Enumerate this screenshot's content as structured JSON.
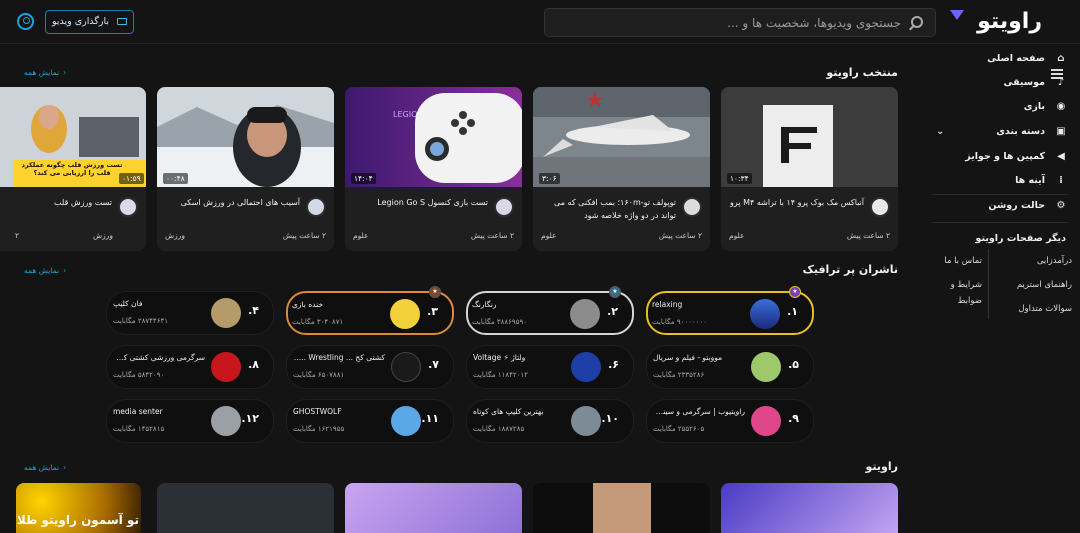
{
  "header": {
    "logo_text": "راویتو",
    "search_placeholder": "جستجوی ویدیوها، شخصیت ها و ...",
    "upload_label": "بارگذاری ویدیو"
  },
  "sidebar": {
    "items": [
      {
        "label": "صفحه اصلی",
        "icon": "home-icon"
      },
      {
        "label": "موسیقی",
        "icon": "music-icon"
      },
      {
        "label": "بازی",
        "icon": "gamepad-icon"
      },
      {
        "label": "دسته بندی",
        "icon": "category-icon"
      },
      {
        "label": "کمپین ها و جوایز",
        "icon": "megaphone-icon"
      },
      {
        "label": "آینه ها",
        "icon": "grid-icon"
      },
      {
        "label": "حالت روشن",
        "icon": "gear-icon"
      }
    ],
    "other_pages_title": "دیگر صفحات راویتو",
    "links_right": [
      "درآمدزایی",
      "راهنمای استریم",
      "سوالات متداول"
    ],
    "links_left": [
      "تماس با ما",
      "شرایط و ضوابط"
    ]
  },
  "sections": {
    "featured_title": "منتخب راویتو",
    "publishers_title": "ناشران پر ترافیک",
    "raveto_title": "راویتو",
    "show_all": "نمایش همه"
  },
  "videos": [
    {
      "title": "آنباکس مک بوک پرو ۱۴ با تراشه M۴ پرو",
      "category": "علوم",
      "age": "۲ ساعت پیش",
      "duration": "۱۰:۳۴"
    },
    {
      "title": "توپولف تو-۱۶۰m؛ بمب افکنی که می تواند در دو واژه خلاصه شود",
      "category": "علوم",
      "age": "۲ ساعت پیش",
      "duration": "۳:۰۶"
    },
    {
      "title": "تست بازی کنسول Legion Go S",
      "category": "علوم",
      "age": "۲ ساعت پیش",
      "duration": "۱۴:۰۴"
    },
    {
      "title": "آسیب های احتمالی در ورزش اسکی",
      "category": "ورزش",
      "age": "۲ ساعت پیش",
      "duration": "۰۰:۴۸"
    },
    {
      "title": "تست ورزش قلب",
      "category": "ورزش",
      "age": "۲",
      "duration": "۰۱:۵۹",
      "thumb_text": "تست ورزش قلب چگونه عملکرد قلب را ارزیابی می کند؟"
    }
  ],
  "publishers": [
    {
      "rank": "۱.",
      "name": "relaxing",
      "count": "۹۰۰۰۰۰۰۰ مگابایت"
    },
    {
      "rank": "۲.",
      "name": "رنگارنگ",
      "count": "۳۸۸۶۹۵۹۰ مگابایت"
    },
    {
      "rank": "۳.",
      "name": "خنده بازی",
      "count": "۳۰۴۰۸۷۱ مگابایت"
    },
    {
      "rank": "۴.",
      "name": "فان کلیپ",
      "count": "۲۸۷۴۴۶۴۱ مگابایت"
    },
    {
      "rank": "۵.",
      "name": "مووبتو - فیلم و سریال",
      "count": "۲۳۳۵۲۸۶ مگابایت"
    },
    {
      "rank": "۶.",
      "name": "ولتاژ ⚡ Voltage",
      "count": "۱۱۸۴۲۰۱۲ مگابایت"
    },
    {
      "rank": "۷.",
      "name": "کشتی کج ... Wrestling ... ر...",
      "count": "۶۵۰۷۸۸۱ مگابایت"
    },
    {
      "rank": "۸.",
      "name": "سرگرمی ورزشی کشتی کج مس...",
      "count": "۵۸۴۲۰۹۰ مگابایت"
    },
    {
      "rank": "۹.",
      "name": "راویتیوب | سرگرمی و سینما...",
      "count": "۲۵۵۲۶۰۵ مگابایت"
    },
    {
      "rank": "۱۰.",
      "name": "بهترین کلیپ های کوتاه",
      "count": "۱۸۸۷۲۸۵ مگابایت"
    },
    {
      "rank": "۱۱.",
      "name": "GHOSTWOLF",
      "count": "۱۶۲۱۹۵۵ مگابایت"
    },
    {
      "rank": "۱۲.",
      "name": "media senter",
      "count": "۱۴۵۲۸۱۵ مگابایت"
    }
  ],
  "bottom_thumb_text": "تو آسمون راویتو طلای"
}
